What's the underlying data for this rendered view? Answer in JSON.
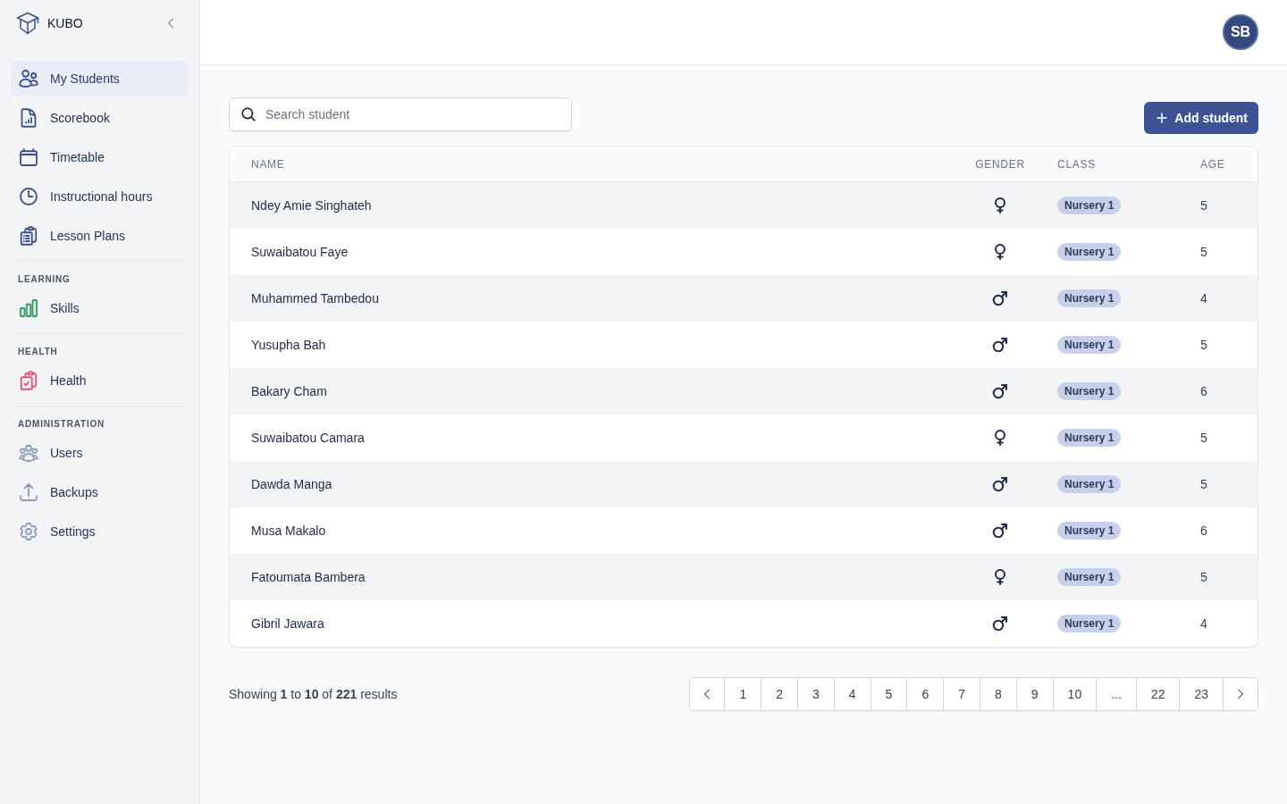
{
  "sidebar": {
    "brand": "KUBO",
    "sections": [
      {
        "items": [
          {
            "label": "My Students",
            "selected": true,
            "color": "#3d4f8a"
          },
          {
            "label": "Scorebook",
            "selected": false,
            "color": "#3d4f8a"
          },
          {
            "label": "Timetable",
            "selected": false,
            "color": "#3d4f8a"
          },
          {
            "label": "Instructional hours",
            "selected": false,
            "color": "#3d4f8a"
          },
          {
            "label": "Lesson Plans",
            "selected": false,
            "color": "#3d4f8a"
          }
        ]
      },
      {
        "title": "LEARNING",
        "items": [
          {
            "label": "Skills",
            "selected": false,
            "color": "#25a05a"
          }
        ]
      },
      {
        "title": "HEALTH",
        "items": [
          {
            "label": "Health",
            "selected": false,
            "color": "#e4507a"
          }
        ]
      },
      {
        "title": "ADMINISTRATION",
        "items": [
          {
            "label": "Users",
            "selected": false,
            "color": "#8d9dbf"
          },
          {
            "label": "Backups",
            "selected": false,
            "color": "#8d9dbf"
          },
          {
            "label": "Settings",
            "selected": false,
            "color": "#8d9dbf"
          }
        ]
      }
    ]
  },
  "header": {
    "avatar": "SB"
  },
  "toolbar": {
    "search": {
      "placeholder": "Search student"
    },
    "add_button": "Add student"
  },
  "table": {
    "columns": [
      "NAME",
      "GENDER",
      "CLASS",
      "AGE"
    ],
    "rows": [
      {
        "name": "Ndey Amie Singhateh",
        "kind": "female",
        "class": "Nursery 1",
        "age": "5"
      },
      {
        "name": "Suwaibatou Faye",
        "kind": "female",
        "class": "Nursery 1",
        "age": "5"
      },
      {
        "name": "Muhammed Tambedou",
        "kind": "male",
        "class": "Nursery 1",
        "age": "4"
      },
      {
        "name": "Yusupha Bah",
        "kind": "male",
        "class": "Nursery 1",
        "age": "5"
      },
      {
        "name": "Bakary Cham",
        "kind": "male",
        "class": "Nursery 1",
        "age": "6"
      },
      {
        "name": "Suwaibatou Camara",
        "kind": "female",
        "class": "Nursery 1",
        "age": "5"
      },
      {
        "name": "Dawda Manga",
        "kind": "male",
        "class": "Nursery 1",
        "age": "5"
      },
      {
        "name": "Musa Makalo",
        "kind": "male",
        "class": "Nursery 1",
        "age": "6"
      },
      {
        "name": "Fatoumata Bambera",
        "kind": "female",
        "class": "Nursery 1",
        "age": "5"
      },
      {
        "name": "Gibril Jawara",
        "kind": "male",
        "class": "Nursery 1",
        "age": "4"
      }
    ]
  },
  "pagination": {
    "summary": "Showing **1** to **10** of **221** results",
    "pages": [
      "1",
      "2",
      "3",
      "4",
      "5",
      "6",
      "7",
      "8",
      "9",
      "10",
      "...",
      "22",
      "23"
    ]
  }
}
